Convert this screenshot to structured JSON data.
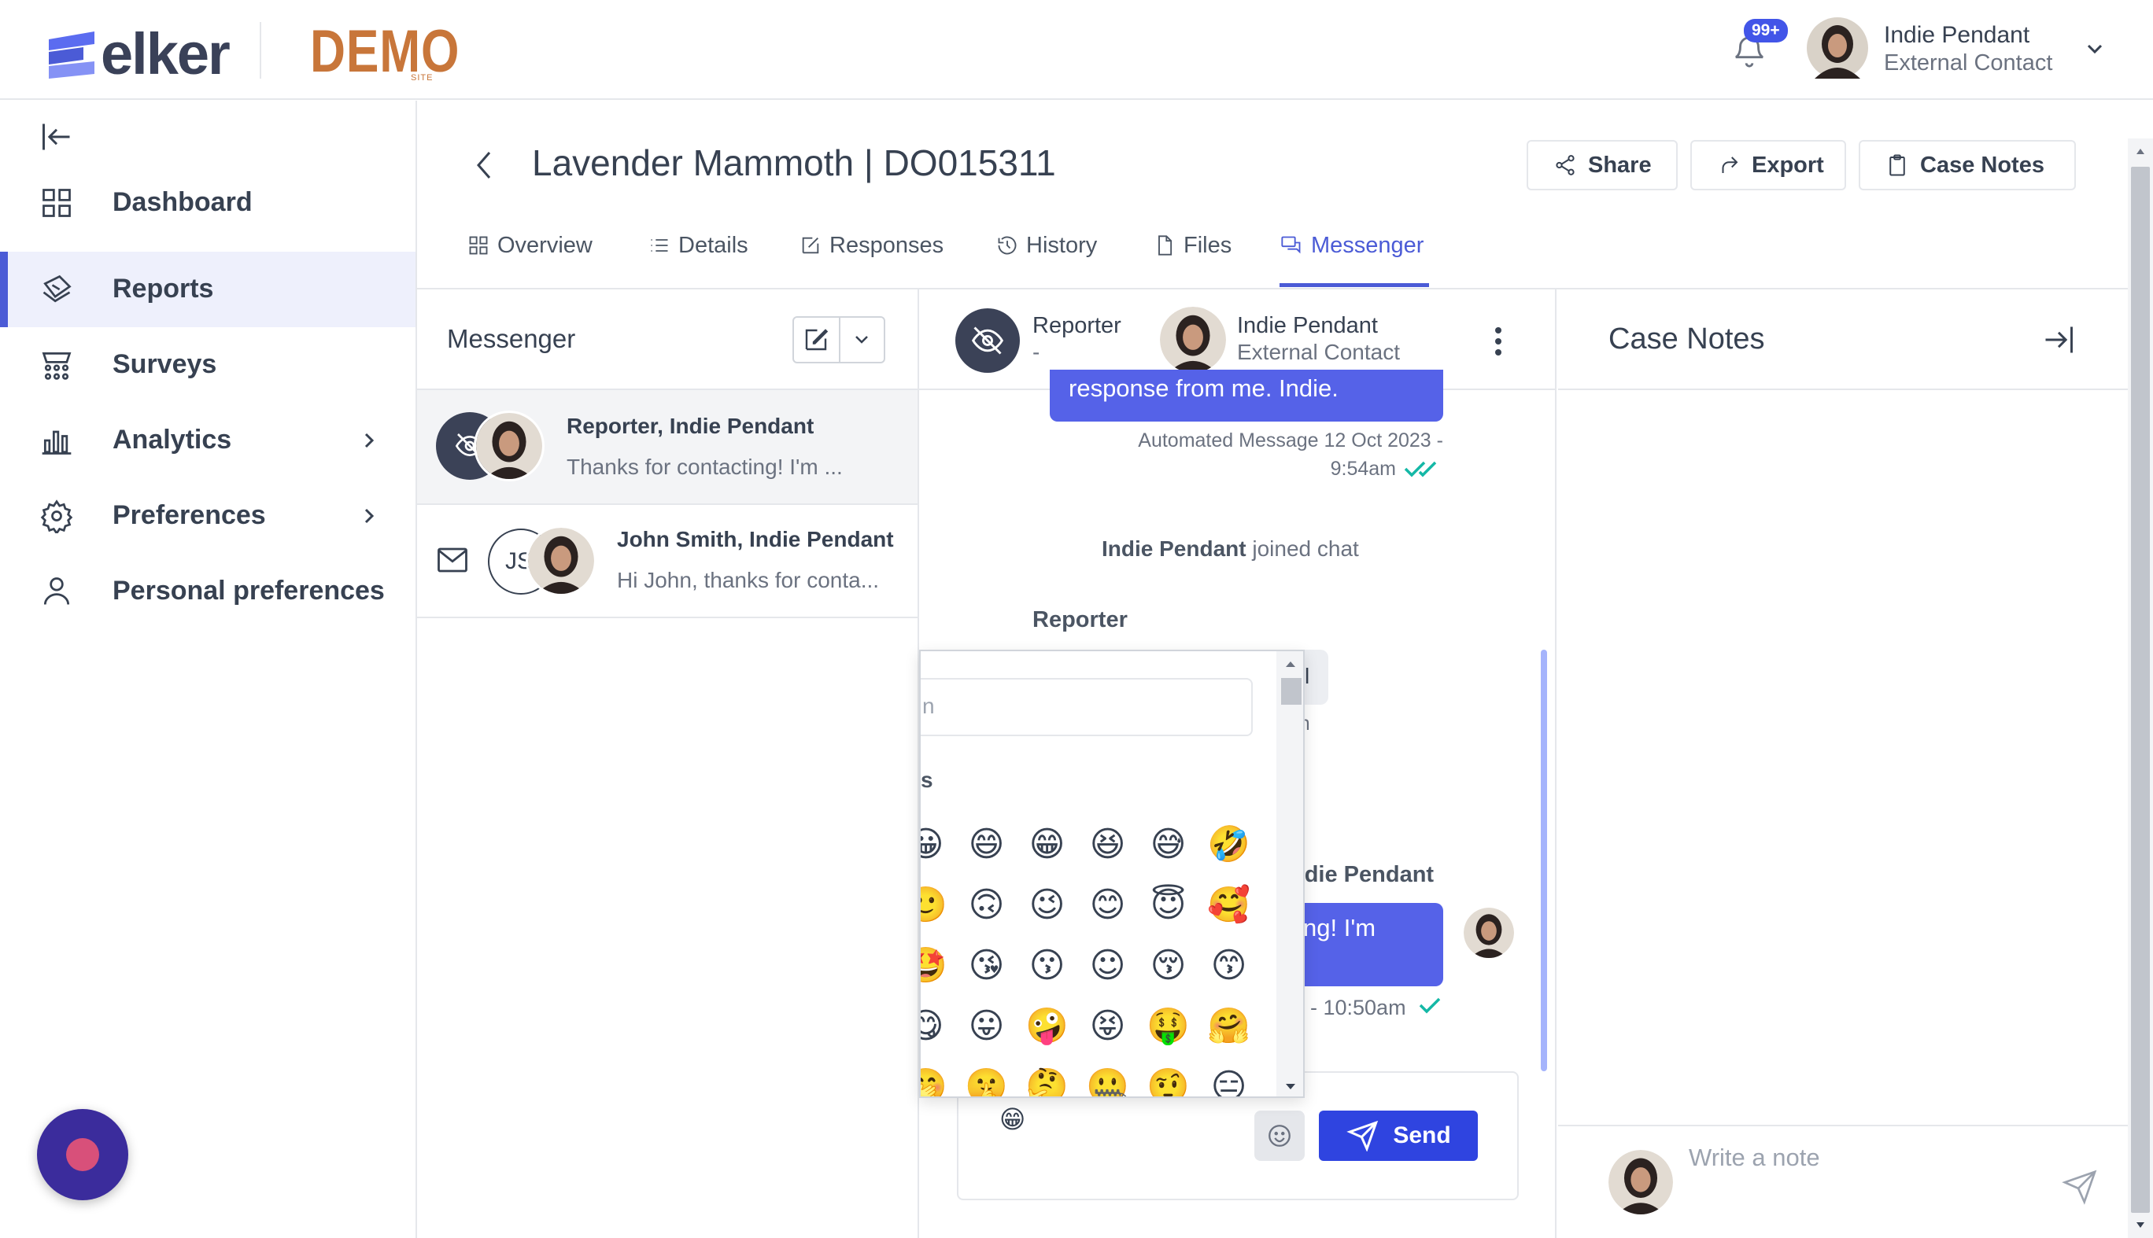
{
  "brand": {
    "name": "elker",
    "site_label": "DEMO",
    "site_sub": "SITE"
  },
  "header": {
    "notification_badge": "99+",
    "user_name": "Indie Pendant",
    "user_role": "External Contact"
  },
  "sidebar": {
    "items": [
      {
        "label": "Dashboard",
        "icon": "dashboard-icon"
      },
      {
        "label": "Reports",
        "icon": "reports-icon",
        "active": true
      },
      {
        "label": "Surveys",
        "icon": "surveys-icon"
      },
      {
        "label": "Analytics",
        "icon": "analytics-icon",
        "has_children": true
      },
      {
        "label": "Preferences",
        "icon": "gear-icon",
        "has_children": true
      },
      {
        "label": "Personal preferences",
        "icon": "user-icon"
      }
    ]
  },
  "page": {
    "title": "Lavender Mammoth | DO015311",
    "actions": {
      "share": "Share",
      "export": "Export",
      "case_notes": "Case Notes"
    },
    "tabs": [
      "Overview",
      "Details",
      "Responses",
      "History",
      "Files",
      "Messenger"
    ],
    "active_tab": "Messenger"
  },
  "messenger_list": {
    "title": "Messenger",
    "conversations": [
      {
        "name": "Reporter, Indie Pendant",
        "snippet": "Thanks for contacting! I'm ..."
      },
      {
        "name": "John Smith, Indie Pendant",
        "snippet": "Hi John, thanks for conta...",
        "initials": "JS"
      }
    ]
  },
  "chat": {
    "participant_1": {
      "name": "Reporter",
      "sub": "-"
    },
    "participant_2": {
      "name": "Indie Pendant",
      "sub": "External Contact"
    },
    "msg1_text": "response from me. Indie.",
    "msg1_meta_line1": "Automated Message 12 Oct 2023 -",
    "msg1_meta_line2": "9:54am",
    "joined_name": "Indie Pendant",
    "joined_text": " joined chat",
    "reporter_label": "Reporter",
    "reporter_fragment_1": "l",
    "reporter_fragment_2": "am",
    "sender_2": "ndie Pendant",
    "msg2_text": "ng! I'm",
    "msg2_meta": "; - 10:50am",
    "composer_value": "😁",
    "send_label": "Send"
  },
  "emoji_picker": {
    "search_fragment": "n",
    "category_fragment": "s",
    "rows": [
      [
        "😀",
        "😄",
        "😁",
        "😆",
        "😅",
        "🤣"
      ],
      [
        "🙂",
        "🙃",
        "😉",
        "😊",
        "😇",
        "🥰"
      ],
      [
        "🤩",
        "😘",
        "😗",
        "☺",
        "😚",
        "😙"
      ],
      [
        "😋",
        "😛",
        "🤪",
        "😝",
        "🤑",
        "🤗"
      ],
      [
        "🤭",
        "🤫",
        "🤔",
        "🤐",
        "🤨",
        "😑"
      ]
    ]
  },
  "case_notes": {
    "title": "Case Notes",
    "placeholder": "Write a note"
  },
  "colors": {
    "accent": "#4b5bd6",
    "send_button": "#2f44e0",
    "brand_orange": "#c8763a"
  }
}
